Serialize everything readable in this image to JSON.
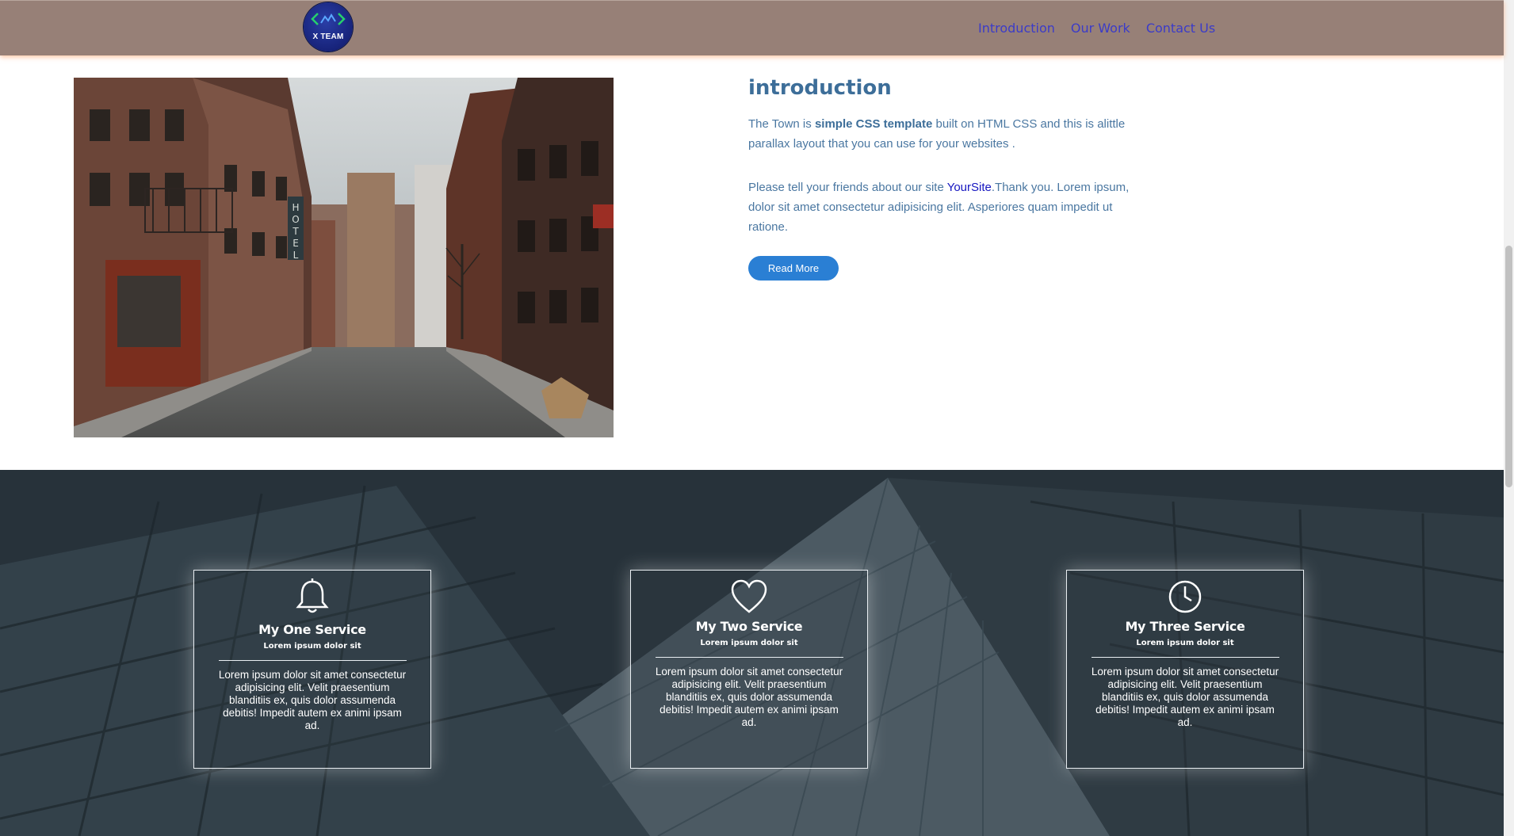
{
  "header": {
    "logo_text": "X TEAM",
    "nav": [
      "Introduction",
      "Our Work",
      "Contact Us"
    ]
  },
  "intro": {
    "title": "introduction",
    "p1_before": "The Town is ",
    "p1_bold": "simple CSS template",
    "p1_after": " built on HTML CSS and this is alittle parallax layout that you can use for your websites .",
    "p2_before": "Please tell your friends about our site ",
    "p2_link": "YourSite",
    "p2_after": ".Thank you. Lorem ipsum, dolor sit amet consectetur adipisicing elit. Asperiores quam impedit ut ratione.",
    "button": "Read More"
  },
  "services": [
    {
      "icon": "bell-icon",
      "title": "My One Service",
      "subtitle": "Lorem ipsum dolor sit",
      "body": "Lorem ipsum dolor sit amet consectetur adipisicing elit. Velit praesentium blanditiis ex, quis dolor assumenda debitis! Impedit autem ex animi ipsam ad."
    },
    {
      "icon": "heart-icon",
      "title": "My Two Service",
      "subtitle": "Lorem ipsum dolor sit",
      "body": "Lorem ipsum dolor sit amet consectetur adipisicing elit. Velit praesentium blanditiis ex, quis dolor assumenda debitis! Impedit autem ex animi ipsam ad."
    },
    {
      "icon": "clock-icon",
      "title": "My Three Service",
      "subtitle": "Lorem ipsum dolor sit",
      "body": "Lorem ipsum dolor sit amet consectetur adipisicing elit. Velit praesentium blanditiis ex, quis dolor assumenda debitis! Impedit autem ex animi ipsam ad."
    }
  ],
  "colors": {
    "navbar": "#978077",
    "nav_link": "#3b3bc8",
    "intro_title": "#3d6e99",
    "intro_text": "#4a77a1",
    "button": "#2a7fd4",
    "services_bg": "#27323a"
  }
}
